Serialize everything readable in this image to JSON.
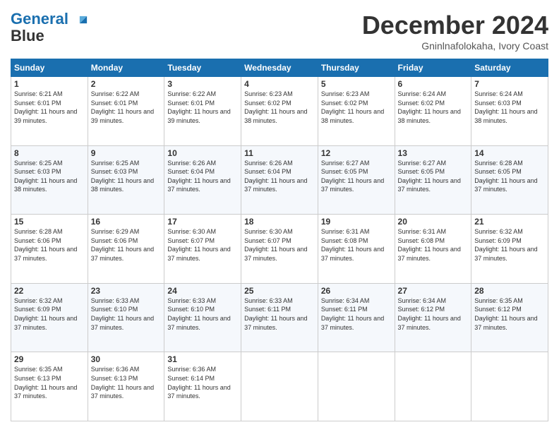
{
  "header": {
    "logo_line1": "General",
    "logo_line2": "Blue",
    "month": "December 2024",
    "location": "Gninlnafolokaha, Ivory Coast"
  },
  "weekdays": [
    "Sunday",
    "Monday",
    "Tuesday",
    "Wednesday",
    "Thursday",
    "Friday",
    "Saturday"
  ],
  "weeks": [
    [
      {
        "day": "1",
        "rise": "6:21 AM",
        "set": "6:01 PM",
        "daylight": "11 hours and 39 minutes."
      },
      {
        "day": "2",
        "rise": "6:22 AM",
        "set": "6:01 PM",
        "daylight": "11 hours and 39 minutes."
      },
      {
        "day": "3",
        "rise": "6:22 AM",
        "set": "6:01 PM",
        "daylight": "11 hours and 39 minutes."
      },
      {
        "day": "4",
        "rise": "6:23 AM",
        "set": "6:02 PM",
        "daylight": "11 hours and 38 minutes."
      },
      {
        "day": "5",
        "rise": "6:23 AM",
        "set": "6:02 PM",
        "daylight": "11 hours and 38 minutes."
      },
      {
        "day": "6",
        "rise": "6:24 AM",
        "set": "6:02 PM",
        "daylight": "11 hours and 38 minutes."
      },
      {
        "day": "7",
        "rise": "6:24 AM",
        "set": "6:03 PM",
        "daylight": "11 hours and 38 minutes."
      }
    ],
    [
      {
        "day": "8",
        "rise": "6:25 AM",
        "set": "6:03 PM",
        "daylight": "11 hours and 38 minutes."
      },
      {
        "day": "9",
        "rise": "6:25 AM",
        "set": "6:03 PM",
        "daylight": "11 hours and 38 minutes."
      },
      {
        "day": "10",
        "rise": "6:26 AM",
        "set": "6:04 PM",
        "daylight": "11 hours and 37 minutes."
      },
      {
        "day": "11",
        "rise": "6:26 AM",
        "set": "6:04 PM",
        "daylight": "11 hours and 37 minutes."
      },
      {
        "day": "12",
        "rise": "6:27 AM",
        "set": "6:05 PM",
        "daylight": "11 hours and 37 minutes."
      },
      {
        "day": "13",
        "rise": "6:27 AM",
        "set": "6:05 PM",
        "daylight": "11 hours and 37 minutes."
      },
      {
        "day": "14",
        "rise": "6:28 AM",
        "set": "6:05 PM",
        "daylight": "11 hours and 37 minutes."
      }
    ],
    [
      {
        "day": "15",
        "rise": "6:28 AM",
        "set": "6:06 PM",
        "daylight": "11 hours and 37 minutes."
      },
      {
        "day": "16",
        "rise": "6:29 AM",
        "set": "6:06 PM",
        "daylight": "11 hours and 37 minutes."
      },
      {
        "day": "17",
        "rise": "6:30 AM",
        "set": "6:07 PM",
        "daylight": "11 hours and 37 minutes."
      },
      {
        "day": "18",
        "rise": "6:30 AM",
        "set": "6:07 PM",
        "daylight": "11 hours and 37 minutes."
      },
      {
        "day": "19",
        "rise": "6:31 AM",
        "set": "6:08 PM",
        "daylight": "11 hours and 37 minutes."
      },
      {
        "day": "20",
        "rise": "6:31 AM",
        "set": "6:08 PM",
        "daylight": "11 hours and 37 minutes."
      },
      {
        "day": "21",
        "rise": "6:32 AM",
        "set": "6:09 PM",
        "daylight": "11 hours and 37 minutes."
      }
    ],
    [
      {
        "day": "22",
        "rise": "6:32 AM",
        "set": "6:09 PM",
        "daylight": "11 hours and 37 minutes."
      },
      {
        "day": "23",
        "rise": "6:33 AM",
        "set": "6:10 PM",
        "daylight": "11 hours and 37 minutes."
      },
      {
        "day": "24",
        "rise": "6:33 AM",
        "set": "6:10 PM",
        "daylight": "11 hours and 37 minutes."
      },
      {
        "day": "25",
        "rise": "6:33 AM",
        "set": "6:11 PM",
        "daylight": "11 hours and 37 minutes."
      },
      {
        "day": "26",
        "rise": "6:34 AM",
        "set": "6:11 PM",
        "daylight": "11 hours and 37 minutes."
      },
      {
        "day": "27",
        "rise": "6:34 AM",
        "set": "6:12 PM",
        "daylight": "11 hours and 37 minutes."
      },
      {
        "day": "28",
        "rise": "6:35 AM",
        "set": "6:12 PM",
        "daylight": "11 hours and 37 minutes."
      }
    ],
    [
      {
        "day": "29",
        "rise": "6:35 AM",
        "set": "6:13 PM",
        "daylight": "11 hours and 37 minutes."
      },
      {
        "day": "30",
        "rise": "6:36 AM",
        "set": "6:13 PM",
        "daylight": "11 hours and 37 minutes."
      },
      {
        "day": "31",
        "rise": "6:36 AM",
        "set": "6:14 PM",
        "daylight": "11 hours and 37 minutes."
      },
      null,
      null,
      null,
      null
    ]
  ]
}
